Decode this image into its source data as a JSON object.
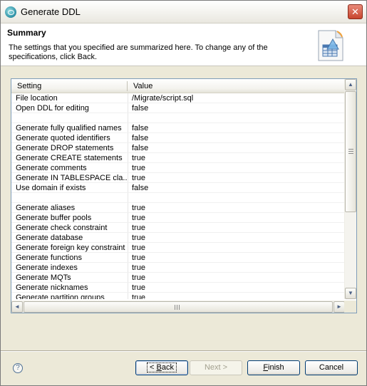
{
  "window": {
    "title": "Generate DDL",
    "close_glyph": "✕"
  },
  "banner": {
    "title": "Summary",
    "description": "The settings that you specified are summarized here. To change any of the specifications, click Back.",
    "icon": "ddl-table-wizard-icon"
  },
  "table": {
    "columns": [
      "Setting",
      "Value"
    ],
    "rows": [
      {
        "setting": "File location",
        "value": "/Migrate/script.sql"
      },
      {
        "setting": "Open DDL for editing",
        "value": "false"
      },
      {
        "setting": "",
        "value": ""
      },
      {
        "setting": "Generate fully qualified names",
        "value": "false"
      },
      {
        "setting": "Generate quoted identifiers",
        "value": "false"
      },
      {
        "setting": "Generate DROP statements",
        "value": "false"
      },
      {
        "setting": "Generate CREATE statements",
        "value": "true"
      },
      {
        "setting": "Generate comments",
        "value": "true"
      },
      {
        "setting": "Generate IN TABLESPACE cla...",
        "value": "true"
      },
      {
        "setting": "Use domain if exists",
        "value": "false"
      },
      {
        "setting": "",
        "value": ""
      },
      {
        "setting": "Generate aliases",
        "value": "true"
      },
      {
        "setting": "Generate buffer pools",
        "value": "true"
      },
      {
        "setting": "Generate check constraint",
        "value": "true"
      },
      {
        "setting": "Generate database",
        "value": "true"
      },
      {
        "setting": "Generate foreign key constraint",
        "value": "true"
      },
      {
        "setting": "Generate functions",
        "value": "true"
      },
      {
        "setting": "Generate indexes",
        "value": "true"
      },
      {
        "setting": "Generate MQTs",
        "value": "true"
      },
      {
        "setting": "Generate nicknames",
        "value": "true"
      },
      {
        "setting": "Generate partition groups",
        "value": "true"
      }
    ]
  },
  "scroll": {
    "up": "▲",
    "down": "▼",
    "left": "◄",
    "right": "►"
  },
  "buttons": {
    "help": "?",
    "back_mnemonic": "< ",
    "back_underlined": "B",
    "back_rest": "ack",
    "next": "Next >",
    "finish_underlined": "F",
    "finish_rest": "inish",
    "cancel": "Cancel"
  }
}
